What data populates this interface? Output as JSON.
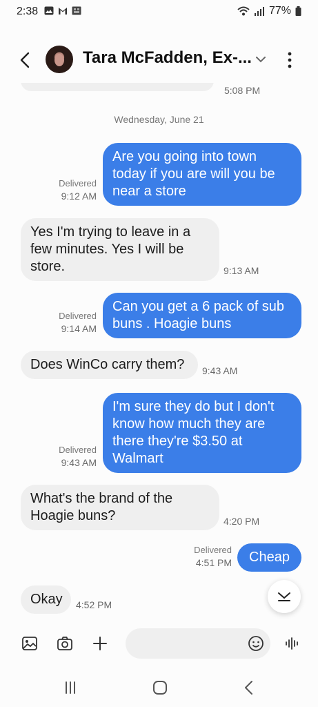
{
  "status": {
    "time": "2:38",
    "battery": "77%"
  },
  "header": {
    "contact_name": "Tara McFadden, Ex-..."
  },
  "top_partial": {
    "time": "5:08 PM"
  },
  "date_separator": "Wednesday, June 21",
  "messages": [
    {
      "dir": "out",
      "lines": [
        "Are you going into town",
        "today if you are will you be",
        "near a store"
      ],
      "status": "Delivered",
      "time": "9:12 AM"
    },
    {
      "dir": "in",
      "lines": [
        "Yes I'm trying to leave in a",
        "few minutes. Yes I will be",
        "store."
      ],
      "time": "9:13 AM"
    },
    {
      "dir": "out",
      "lines": [
        "Can you get a 6 pack of sub",
        "buns . Hoagie buns"
      ],
      "status": "Delivered",
      "time": "9:14 AM"
    },
    {
      "dir": "in",
      "lines": [
        "Does WinCo carry them?"
      ],
      "time": "9:43 AM"
    },
    {
      "dir": "out",
      "lines": [
        "I'm sure they do but I don't",
        "know how much they are",
        "there they're $3.50 at",
        "Walmart"
      ],
      "status": "Delivered",
      "time": "9:43 AM"
    },
    {
      "dir": "in",
      "lines": [
        "What's the brand of the",
        "Hoagie buns?"
      ],
      "time": "4:20 PM"
    },
    {
      "dir": "out",
      "lines": [
        "Cheap"
      ],
      "status": "Delivered",
      "time": "4:51 PM"
    },
    {
      "dir": "in",
      "lines": [
        "Okay"
      ],
      "time": "4:52 PM"
    }
  ],
  "icons": {
    "status": [
      "gallery-icon",
      "gmail-icon",
      "app-icon",
      "wifi-icon",
      "signal-icon",
      "battery-icon"
    ],
    "input": [
      "gallery-icon",
      "camera-icon",
      "plus-icon",
      "emoji-icon",
      "voice-icon"
    ],
    "nav": [
      "recents-icon",
      "home-icon",
      "back-icon"
    ]
  },
  "colors": {
    "outgoing_bubble": "#3b7ee8",
    "incoming_bubble": "#efefef",
    "background": "#fcfcfc"
  }
}
